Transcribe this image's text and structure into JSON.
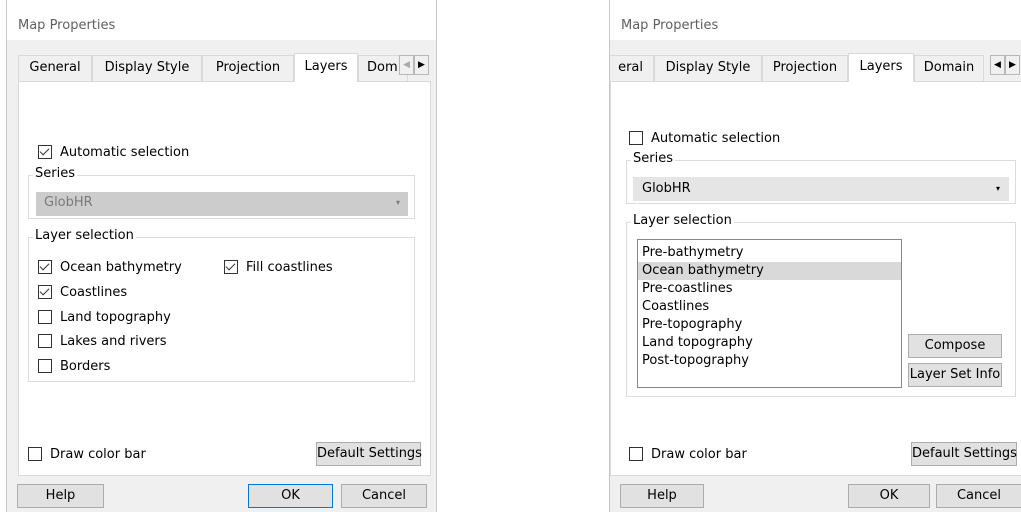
{
  "left": {
    "title": "Map Properties",
    "tabs": [
      "General",
      "Display Style",
      "Projection",
      "Layers",
      "Dom"
    ],
    "auto_selection_label": "Automatic selection",
    "series_label": "Series",
    "series_value": "GlobHR",
    "layer_selection_label": "Layer selection",
    "layers": {
      "ocean_bathymetry": "Ocean bathymetry",
      "fill_coastlines": "Fill coastlines",
      "coastlines": "Coastlines",
      "land_topography": "Land topography",
      "lakes_and_rivers": "Lakes and rivers",
      "borders": "Borders"
    },
    "draw_color_bar_label": "Draw color bar",
    "default_settings_label": "Default Settings",
    "help_label": "Help",
    "ok_label": "OK",
    "cancel_label": "Cancel"
  },
  "right": {
    "title": "Map Properties",
    "tabs": [
      "eral",
      "Display Style",
      "Projection",
      "Layers",
      "Domain"
    ],
    "auto_selection_label": "Automatic selection",
    "series_label": "Series",
    "series_value": "GlobHR",
    "layer_selection_label": "Layer selection",
    "list_items": [
      "Pre-bathymetry",
      "Ocean bathymetry",
      "Pre-coastlines",
      "Coastlines",
      "Pre-topography",
      "Land topography",
      "Post-topography"
    ],
    "selected_item": "Ocean bathymetry",
    "compose_label": "Compose",
    "layer_set_info_label": "Layer Set Info",
    "draw_color_bar_label": "Draw color bar",
    "default_settings_label": "Default Settings",
    "help_label": "Help",
    "ok_label": "OK",
    "cancel_label": "Cancel"
  }
}
